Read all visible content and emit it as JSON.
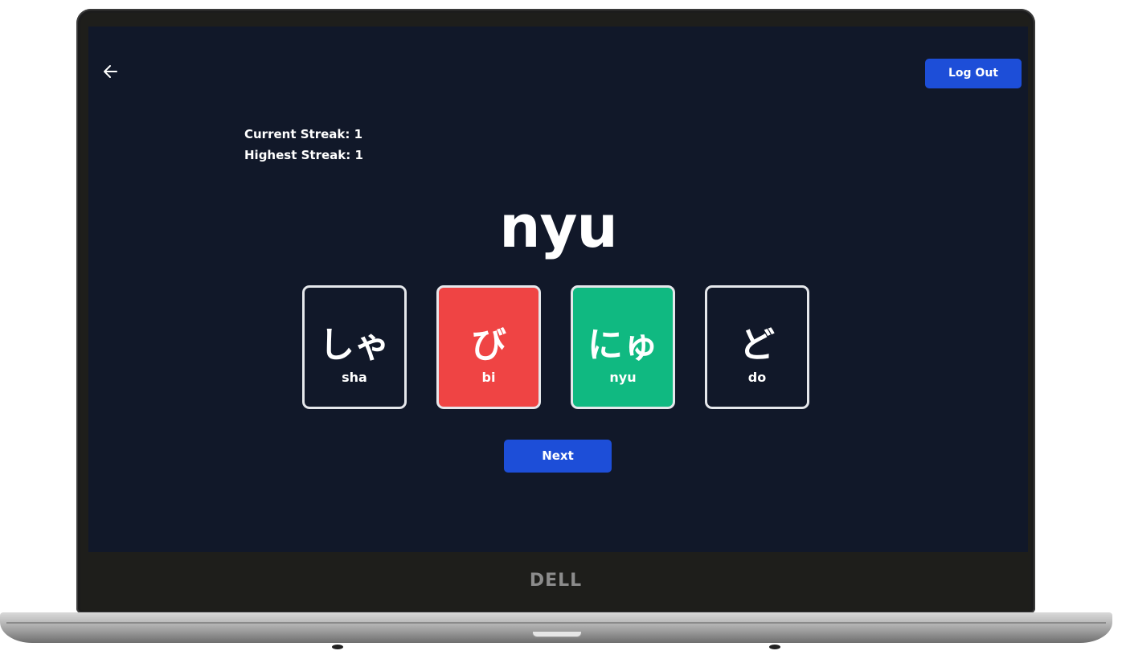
{
  "device": {
    "brand_logo": "DELL"
  },
  "header": {
    "back_icon": "arrow-left-icon",
    "logout_label": "Log Out"
  },
  "stats": {
    "current_streak": "Current Streak: 1",
    "highest_streak": "Highest Streak: 1"
  },
  "quiz": {
    "prompt": "nyu",
    "choices": [
      {
        "kana": "しゃ",
        "romaji": "sha",
        "state": "default"
      },
      {
        "kana": "び",
        "romaji": "bi",
        "state": "wrong"
      },
      {
        "kana": "にゅ",
        "romaji": "nyu",
        "state": "correct"
      },
      {
        "kana": "ど",
        "romaji": "do",
        "state": "default"
      }
    ],
    "next_label": "Next"
  },
  "colors": {
    "background": "#111829",
    "accent": "#1d4ed8",
    "wrong": "#ef4444",
    "correct": "#10b981",
    "card_border": "#e5e7eb"
  }
}
